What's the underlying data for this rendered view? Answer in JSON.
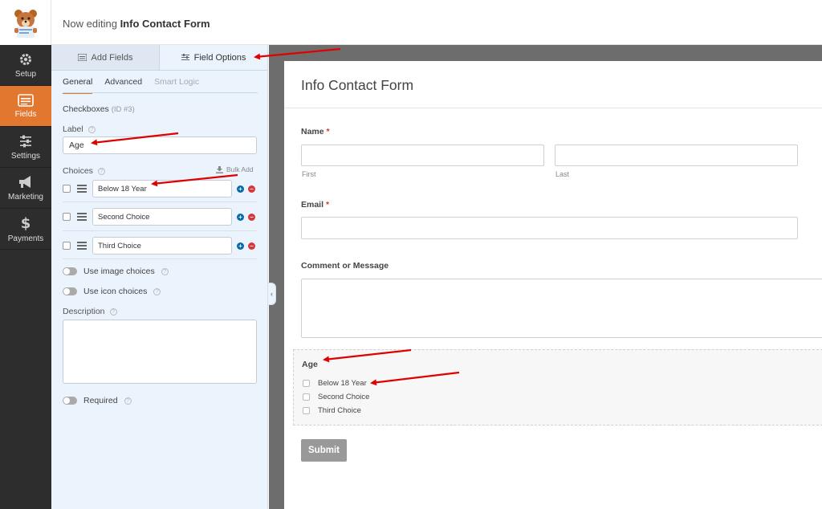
{
  "header": {
    "editing_prefix": "Now editing",
    "form_name": "Info Contact Form"
  },
  "nav": {
    "items": [
      {
        "label": "Setup",
        "icon": "gear-icon"
      },
      {
        "label": "Fields",
        "icon": "fields-icon"
      },
      {
        "label": "Settings",
        "icon": "sliders-icon"
      },
      {
        "label": "Marketing",
        "icon": "megaphone-icon"
      },
      {
        "label": "Payments",
        "icon": "dollar-icon"
      }
    ]
  },
  "panel": {
    "tabs": {
      "add_fields": "Add Fields",
      "field_options": "Field Options"
    },
    "subtabs": [
      "General",
      "Advanced",
      "Smart Logic"
    ],
    "field_type": "Checkboxes",
    "field_id": "(ID #3)",
    "label_caption": "Label",
    "label_value": "Age",
    "choices_caption": "Choices",
    "bulk_add": "Bulk Add",
    "choices": [
      "Below 18 Year",
      "Second Choice",
      "Third Choice"
    ],
    "use_image_choices": "Use image choices",
    "use_icon_choices": "Use icon choices",
    "description_caption": "Description",
    "required": "Required"
  },
  "preview": {
    "title": "Info Contact Form",
    "name_label": "Name",
    "first_sub": "First",
    "last_sub": "Last",
    "email_label": "Email",
    "comment_label": "Comment or Message",
    "age_label": "Age",
    "age_choices": [
      "Below 18 Year",
      "Second Choice",
      "Third Choice"
    ],
    "required_mark": "*",
    "submit": "Submit"
  },
  "colors": {
    "accent": "#e27730",
    "nav_bg": "#2d2d2d",
    "panel_bg": "#ebf3fc",
    "annotation_arrow": "#e00000"
  }
}
